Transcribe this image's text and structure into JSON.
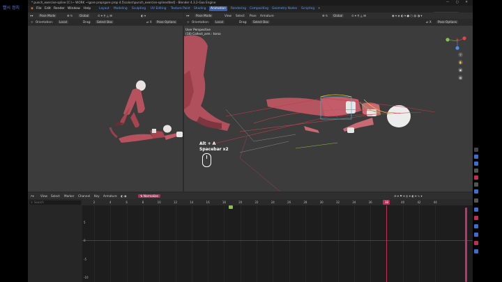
{
  "left_strip_label": "빨시 정치",
  "title_bar": {
    "text": "* punch_exercise-spline [C:\\~ WORK ~\\gore prop\\gore prop 4.5\\colors\\punch_exercise-splinedited] - Blender 4.3.2-Goo Engine"
  },
  "menu": [
    "File",
    "Edit",
    "Render",
    "Window",
    "Help"
  ],
  "workspaces": {
    "tabs": [
      "Layout",
      "Modeling",
      "Sculpting",
      "UV Editing",
      "Texture Paint",
      "Shading",
      "Animation",
      "Rendering",
      "Compositing",
      "Geometry Nodes",
      "Scripting"
    ],
    "active_index": 6,
    "add": "+"
  },
  "scene": {
    "name": "Camera"
  },
  "viewport_left": {
    "mode": "Pose Mode",
    "transform_orientation": "Global",
    "orientation_label": "Orientation:",
    "orientation_value": "Local",
    "drag_label": "Drag:",
    "drag_value": "Select Box",
    "pose_options": "Pose Options"
  },
  "viewport_right": {
    "mode": "Pose Mode",
    "menus": [
      "View",
      "Select",
      "Pose",
      "Armature"
    ],
    "transform_orientation": "Global",
    "orientation_label": "Orientation:",
    "orientation_value": "Local",
    "drag_label": "Drag:",
    "drag_value": "Select Box",
    "pose_options": "Pose Options",
    "perspective": "User Perspective",
    "active_info": "(18) Collect_arm : torso"
  },
  "overlay": {
    "line1": "Alt + A",
    "line2": "Spacebar x2"
  },
  "graph_editor": {
    "menus": [
      "View",
      "Select",
      "Marker",
      "Channel",
      "Key",
      "Armature"
    ],
    "normalize": "Normalize",
    "search_placeholder": "Search",
    "frames": [
      "2",
      "4",
      "6",
      "8",
      "10",
      "12",
      "14",
      "16",
      "18",
      "20",
      "22",
      "24",
      "26",
      "28",
      "30",
      "32",
      "34",
      "36",
      "38",
      "40",
      "42",
      "44"
    ],
    "current_frame": "38",
    "value_ticks": [
      "5",
      "0",
      "-5",
      "-10"
    ]
  },
  "colors": {
    "accent": "#c12d57",
    "workspace_active": "#3b5ea8",
    "axis_x": "#e04848",
    "axis_y": "#8bc34a",
    "axis_z": "#4a8ff0"
  }
}
